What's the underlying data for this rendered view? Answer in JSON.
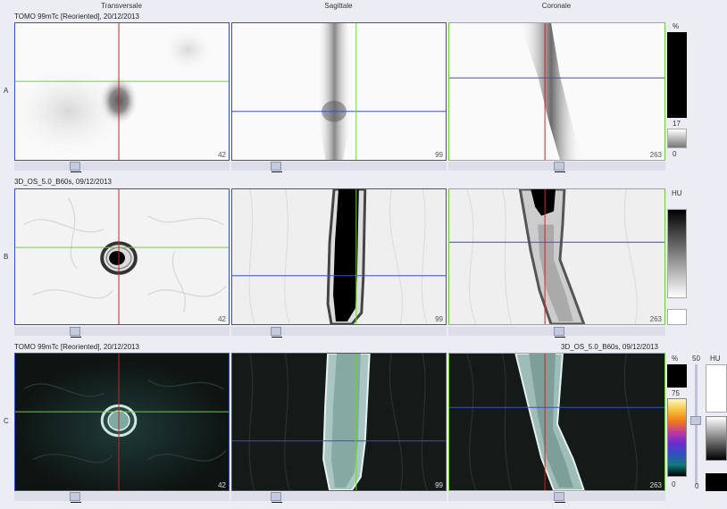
{
  "columns": {
    "transverse": "Transversale",
    "sagittal": "Sagittale",
    "coronal": "Coronale"
  },
  "rows": {
    "a": {
      "letter": "A",
      "title": "TOMO 99mTc [Reoriented], 20/12/2013"
    },
    "b": {
      "letter": "B",
      "title": "3D_OS_5.0_B60s, 09/12/2013"
    },
    "c": {
      "letter": "C",
      "title_left": "TOMO 99mTc [Reoriented], 20/12/2013",
      "title_right": "3D_OS_5.0_B60s, 09/12/2013"
    }
  },
  "slices": {
    "transverse": "42",
    "sagittal": "99",
    "coronal": "263"
  },
  "scales": {
    "a": {
      "unit": "%",
      "value": "17",
      "min": "0"
    },
    "b": {
      "unit": "HU"
    },
    "c": {
      "pct_unit": "%",
      "pct_value": "75",
      "pct_min": "0",
      "mix": "50",
      "hu_unit": "HU"
    }
  },
  "colors": {
    "crosshair_red": "#c0282a",
    "crosshair_green": "#6fcf3c",
    "crosshair_blue": "#3a4fc4",
    "background": "#ecedf4"
  }
}
